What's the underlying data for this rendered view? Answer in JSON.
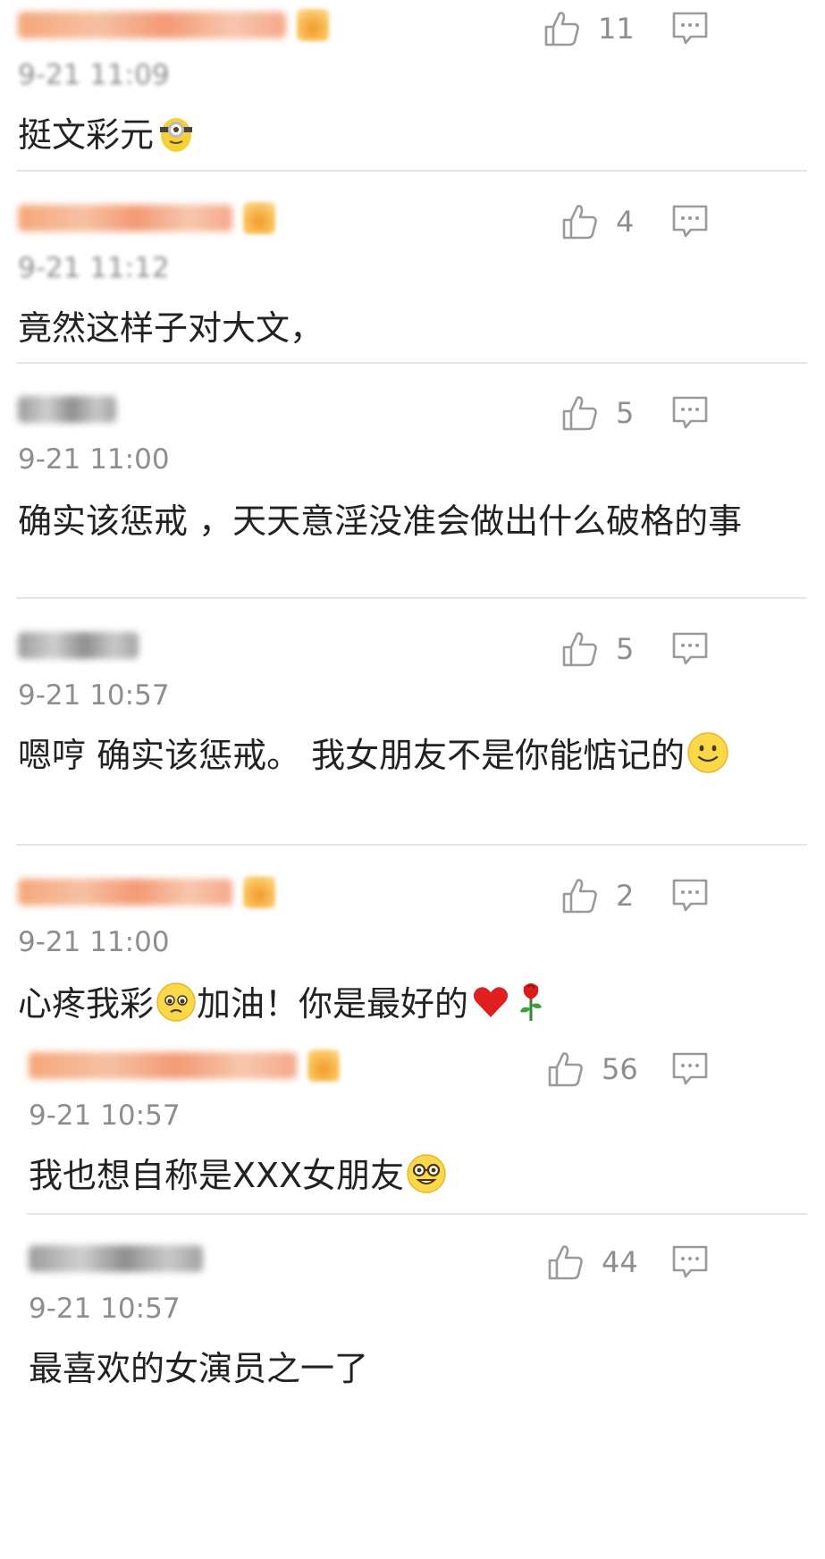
{
  "colors": {
    "text": "#222222",
    "meta_gray": "#8e8e8e",
    "divider": "#e6e6e6",
    "heart": "#e02020"
  },
  "icons": {
    "like": "thumbs-up-outline-icon",
    "reply": "comment-bubble-icon",
    "vip": "vip-badge-icon"
  },
  "comments": [
    {
      "time": "9-21 11:09",
      "likes": "11",
      "text": "挺文彩元",
      "emoji": [
        "minion-emoji"
      ]
    },
    {
      "time": "9-21 11:12",
      "likes": "4",
      "text": "竟然这样子对大文，",
      "emoji": []
    },
    {
      "time": "9-21 11:00",
      "likes": "5",
      "text": "确实该惩戒 ，天天意淫没准会做出什么破格的事",
      "emoji": []
    },
    {
      "time": "9-21 10:57",
      "likes": "5",
      "text": "嗯哼 确实该惩戒。 我女朋友不是你能惦记的",
      "emoji": [
        "smile-emoji"
      ]
    },
    {
      "time": "9-21 11:00",
      "likes": "2",
      "text_a": "心疼我彩",
      "text_b": "加油！你是最好的",
      "emoji": [
        "pleading-emoji",
        "heart-emoji",
        "rose-emoji"
      ]
    },
    {
      "time": "9-21 10:57",
      "likes": "56",
      "text": "我也想自称是XXX女朋友",
      "emoji": [
        "nerd-emoji"
      ]
    },
    {
      "time": "9-21 10:57",
      "likes": "44",
      "text": "最喜欢的女演员之一了",
      "emoji": []
    }
  ]
}
